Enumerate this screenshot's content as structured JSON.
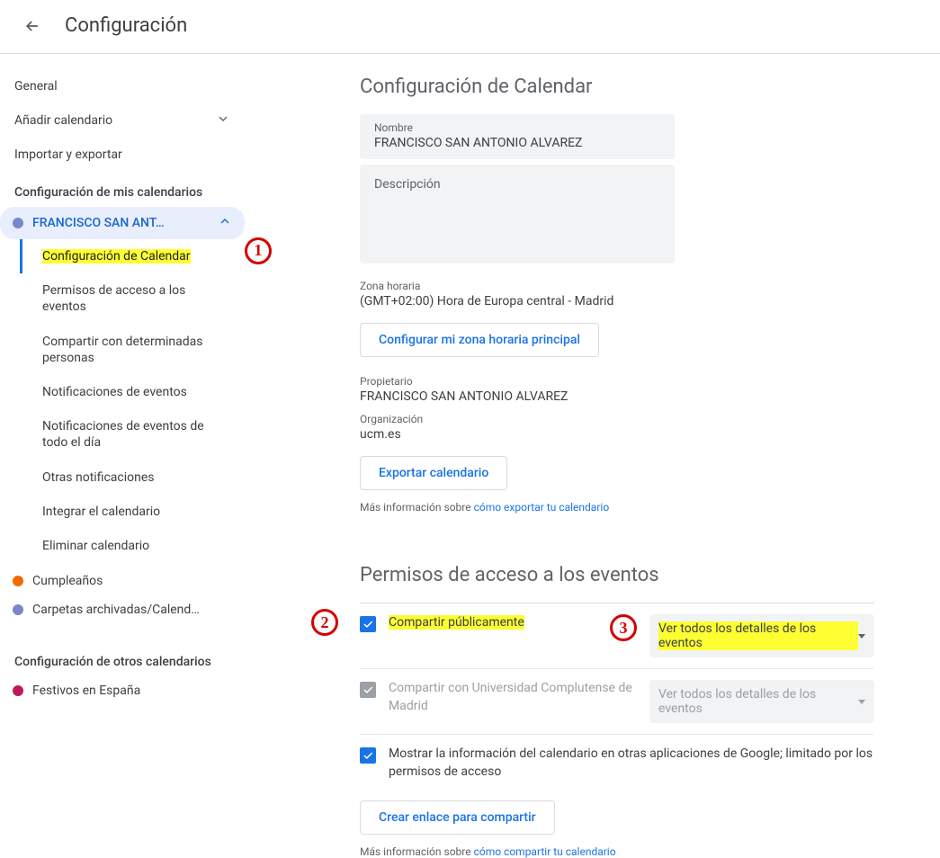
{
  "header": {
    "title": "Configuración"
  },
  "sidebar": {
    "general": "General",
    "add_calendar": "Añadir calendario",
    "import_export": "Importar y exportar",
    "my_calendars_heading": "Configuración de mis calendarios",
    "selected_calendar": "FRANCISCO SAN ANT…",
    "sub": {
      "config": "Configuración de Calendar",
      "permisos": "Permisos de acceso a los eventos",
      "compartir": "Compartir con determinadas personas",
      "notif_eventos": "Notificaciones de eventos",
      "notif_dia": "Notificaciones de eventos de todo el día",
      "otras_notif": "Otras notificaciones",
      "integrar": "Integrar el calendario",
      "eliminar": "Eliminar calendario"
    },
    "other_cal_1": "Cumpleaños",
    "other_cal_2": "Carpetas archivadas/Calend…",
    "other_calendars_heading": "Configuración de otros calendarios",
    "festivos": "Festivos en España"
  },
  "main": {
    "section_title": "Configuración de Calendar",
    "name_field_label": "Nombre",
    "name_field_value": "FRANCISCO SAN ANTONIO ALVAREZ",
    "desc_label": "Descripción",
    "tz_label": "Zona horaria",
    "tz_value": "(GMT+02:00) Hora de Europa central - Madrid",
    "tz_button": "Configurar mi zona horaria principal",
    "owner_label": "Propietario",
    "owner_value": "FRANCISCO SAN ANTONIO ALVAREZ",
    "org_label": "Organización",
    "org_value": "ucm.es",
    "export_button": "Exportar calendario",
    "export_info_prefix": "Más información sobre ",
    "export_info_link": "cómo exportar tu calendario",
    "perms_title": "Permisos de acceso a los eventos",
    "perm_public": "Compartir públicamente",
    "perm_public_dd": "Ver todos los detalles de los eventos",
    "perm_org": "Compartir con Universidad Complutense de Madrid",
    "perm_org_dd": "Ver todos los detalles de los eventos",
    "perm_apps": "Mostrar la información del calendario en otras aplicaciones de Google; limitado por los permisos de acceso",
    "share_link_button": "Crear enlace para compartir",
    "share_info_prefix": "Más información sobre ",
    "share_info_link": "cómo compartir tu calendario"
  },
  "annotations": {
    "one": "1",
    "two": "2",
    "three": "3"
  }
}
